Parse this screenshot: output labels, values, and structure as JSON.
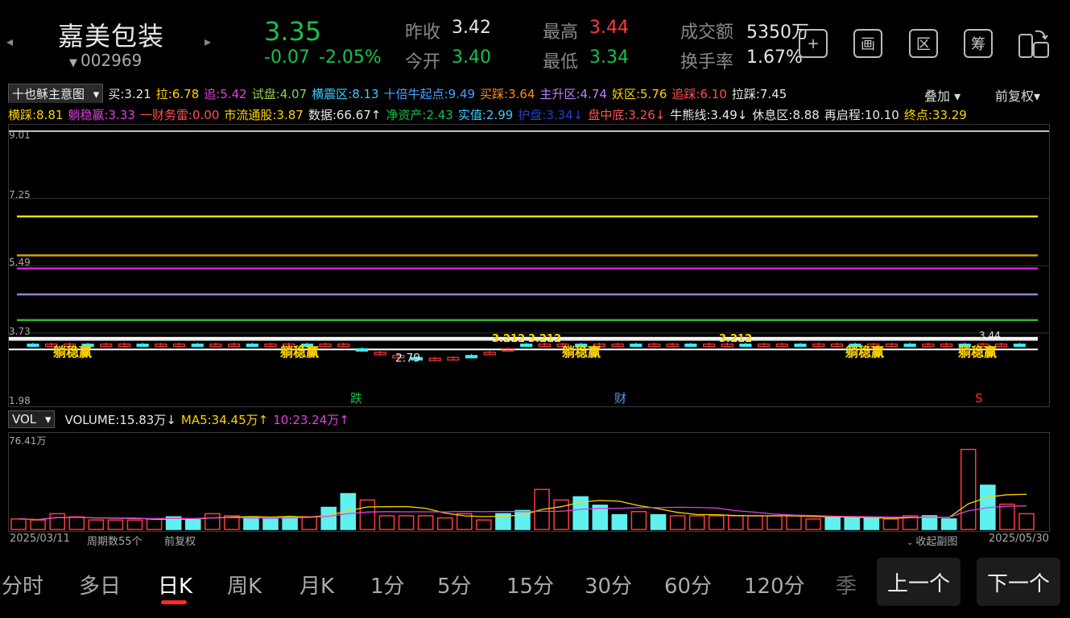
{
  "header": {
    "name": "嘉美包装",
    "code": "002969",
    "price": "3.35",
    "change": "-0.07",
    "change_pct": "-2.05%",
    "prev_close_label": "昨收",
    "prev_close": "3.42",
    "open_label": "今开",
    "open": "3.40",
    "high_label": "最高",
    "high": "3.44",
    "low_label": "最低",
    "low": "3.34",
    "amount_label": "成交额",
    "amount": "5350万",
    "turnover_label": "换手率",
    "turnover": "1.67%",
    "tools": [
      "+",
      "画",
      "区",
      "筹"
    ]
  },
  "indicator": {
    "name": "十也稣主意图",
    "row1": [
      {
        "label": "买:3.21",
        "color": "#e8e8e8"
      },
      {
        "label": "拉:6.78",
        "color": "#ffd400"
      },
      {
        "label": "追:5.42",
        "color": "#e040e0"
      },
      {
        "label": "试盘:4.07",
        "color": "#8fd14f"
      },
      {
        "label": "横震区:8.13",
        "color": "#40c8ff"
      },
      {
        "label": "十倍牛起点:9.49",
        "color": "#4aa0ff"
      },
      {
        "label": "买踩:3.64",
        "color": "#ff8c1a"
      },
      {
        "label": "主升区:4.74",
        "color": "#c080ff"
      },
      {
        "label": "妖区:5.76",
        "color": "#ffd400"
      },
      {
        "label": "追踩:6.10",
        "color": "#ff5050"
      },
      {
        "label": "拉踩:7.45",
        "color": "#e8e8e8"
      }
    ],
    "row2": [
      {
        "label": "横踩:8.81",
        "color": "#ffd400"
      },
      {
        "label": "躺稳赢:3.33",
        "color": "#e040e0"
      },
      {
        "label": "一财务雷:0.00",
        "color": "#ff5050"
      },
      {
        "label": "市流通股:3.87",
        "color": "#ffd400"
      },
      {
        "label": "数据:66.67↑",
        "color": "#e8e8e8"
      },
      {
        "label": "净资产:2.43",
        "color": "#18c04a"
      },
      {
        "label": "实值:2.99",
        "color": "#40c8ff"
      },
      {
        "label": "护盘:3.34↓",
        "color": "#2040d0"
      },
      {
        "label": "盘中底:3.26↓",
        "color": "#ff5050"
      },
      {
        "label": "牛熊线:3.49↓",
        "color": "#e8e8e8"
      },
      {
        "label": "休息区:8.88",
        "color": "#e8e8e8"
      },
      {
        "label": "再启程:10.10",
        "color": "#e8e8e8"
      },
      {
        "label": "终点:33.29",
        "color": "#ffd400"
      }
    ],
    "overlay": "叠加",
    "adjust": "前复权"
  },
  "main_chart": {
    "y_ticks": [
      "9.01",
      "7.25",
      "5.49",
      "3.73",
      "1.98"
    ],
    "lines": [
      {
        "value": 9.01,
        "color": "#ffffff"
      },
      {
        "value": 6.78,
        "color": "#e6e600"
      },
      {
        "value": 5.76,
        "color": "#d4a017"
      },
      {
        "value": 5.42,
        "color": "#e020e0"
      },
      {
        "value": 4.74,
        "color": "#9d7fd6"
      },
      {
        "value": 4.07,
        "color": "#2eb82e"
      }
    ],
    "labels": [
      "躺稳赢",
      "躺稳赢",
      "躺稳赢",
      "躺稳赢",
      "躺稳赢"
    ],
    "low_label": "2.79",
    "high_label": "3.44",
    "buy_marks": [
      "3.212",
      "3.212",
      "3.212"
    ],
    "signals": [
      {
        "text": "跌",
        "color": "#18c04a"
      },
      {
        "text": "财",
        "color": "#4aa0ff"
      },
      {
        "text": "S",
        "color": "#ff2a2a"
      }
    ]
  },
  "volume": {
    "label": "VOL",
    "volume_text": "VOLUME:15.83万↓",
    "ma5_text": "MA5:34.45万↑",
    "ma10_text": "10:23.24万↑",
    "max_label": "76.41万"
  },
  "footer": {
    "start_date": "2025/03/11",
    "period": "周期数55个",
    "adjust": "前复权",
    "collapse": "收起副图",
    "end_date": "2025/05/30"
  },
  "tabs": [
    "分时",
    "多日",
    "日K",
    "周K",
    "月K",
    "1分",
    "5分",
    "15分",
    "30分",
    "60分",
    "120分",
    "季"
  ],
  "active_tab": "日K",
  "prev_button": "上一个",
  "next_button": "下一个",
  "chart_data": {
    "type": "bar",
    "title": "",
    "ylabel": "",
    "ylim": [
      0,
      76.41
    ],
    "series": [
      {
        "values": [
          10,
          9,
          15,
          12,
          9,
          9,
          9,
          10,
          12,
          9,
          15,
          13,
          12,
          10,
          12,
          12,
          21,
          34,
          28,
          13,
          13,
          13,
          11,
          15,
          9,
          15,
          18,
          38,
          28,
          31,
          23,
          14,
          17,
          14,
          13,
          13,
          13,
          13,
          13,
          13,
          13,
          10,
          11,
          11,
          11,
          10,
          13,
          13,
          10,
          76,
          42,
          24,
          15
        ]
      }
    ]
  }
}
